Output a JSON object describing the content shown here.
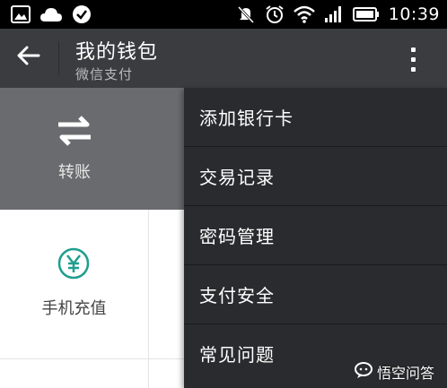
{
  "status_bar": {
    "time": "10:39",
    "left_icons": [
      "gallery-icon",
      "cloud-icon",
      "check-circle-icon"
    ],
    "right_icons": [
      "mute-icon",
      "alarm-icon",
      "wifi-icon",
      "signal-icon",
      "battery-icon"
    ]
  },
  "action_bar": {
    "title": "我的钱包",
    "subtitle": "微信支付",
    "back_icon": "arrow-left-icon",
    "overflow_icon": "more-vertical-icon"
  },
  "page": {
    "tiles": [
      {
        "label": "转账",
        "icon": "transfer-arrows-icon"
      },
      {
        "label": "手机充值",
        "icon": "yen-circle-icon"
      }
    ]
  },
  "menu": {
    "items": [
      {
        "label": "添加银行卡"
      },
      {
        "label": "交易记录"
      },
      {
        "label": "密码管理"
      },
      {
        "label": "支付安全"
      },
      {
        "label": "常见问题"
      }
    ]
  },
  "watermark": {
    "text": "悟空问答"
  },
  "colors": {
    "status_bar": "#000000",
    "action_bar": "#3a3c3f",
    "menu_bg": "#2a2b2e",
    "accent_teal": "#1f9e8f"
  }
}
